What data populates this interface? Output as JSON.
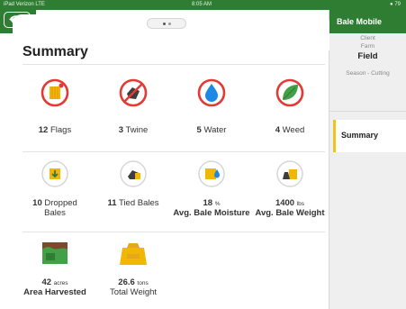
{
  "status_bar": {
    "left": "iPad  Verizon  LTE",
    "time": "8:05 AM",
    "right": "● 79"
  },
  "colors": {
    "brand_green": "#2f7d32",
    "accent_yellow": "#f0c419",
    "alert_red": "#e53935"
  },
  "page": {
    "title": "Summary"
  },
  "sidebar": {
    "title": "Bale Mobile",
    "client": "Client",
    "farm": "Farm",
    "field": "Field",
    "season": "Season - Cutting",
    "selected_item": "Summary"
  },
  "metrics": {
    "flags": {
      "value": "12",
      "label": "Flags"
    },
    "twine": {
      "value": "3",
      "label": "Twine"
    },
    "water": {
      "value": "5",
      "label": "Water"
    },
    "weed": {
      "value": "4",
      "label": "Weed"
    },
    "dropped": {
      "value": "10",
      "label_1": "Dropped",
      "label_2": "Bales"
    },
    "tied": {
      "value": "11",
      "label": "Tied Bales"
    },
    "moisture": {
      "value": "18",
      "unit": "%",
      "label": "Avg. Bale Moisture"
    },
    "weight": {
      "value": "1400",
      "unit": "lbs",
      "label": "Avg. Bale Weight"
    },
    "area": {
      "value": "42",
      "unit": "acres",
      "label": "Area Harvested"
    },
    "total": {
      "value": "26.6",
      "unit": "tons",
      "label": "Total Weight"
    }
  },
  "icons": [
    "back-icon",
    "flag-bale-icon",
    "twine-icon",
    "water-drop-icon",
    "weed-leaf-icon",
    "dropped-bale-icon",
    "tied-bale-icon",
    "moisture-bale-icon",
    "weight-bale-icon",
    "field-area-icon",
    "weight-ton-icon"
  ]
}
